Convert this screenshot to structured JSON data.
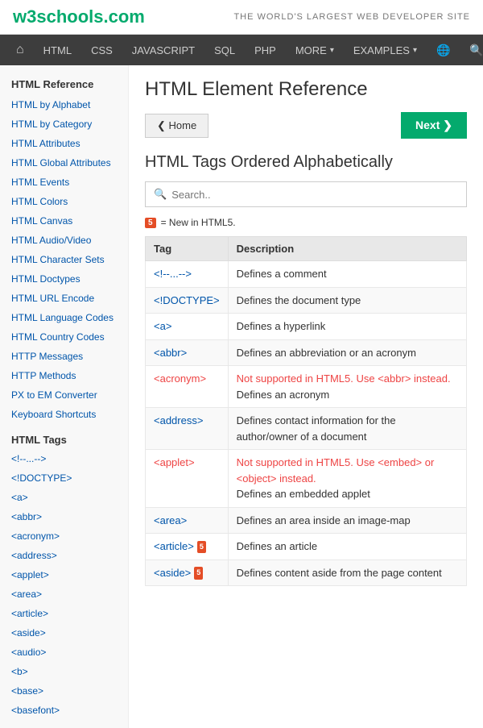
{
  "header": {
    "logo_text": "w3schools",
    "logo_tld": ".com",
    "tagline": "THE WORLD'S LARGEST WEB DEVELOPER SITE"
  },
  "nav": {
    "items": [
      {
        "label": "🏠",
        "id": "home",
        "isIcon": true
      },
      {
        "label": "HTML"
      },
      {
        "label": "CSS"
      },
      {
        "label": "JAVASCRIPT"
      },
      {
        "label": "SQL"
      },
      {
        "label": "PHP"
      },
      {
        "label": "MORE ▾"
      },
      {
        "label": "EXAMPLES ▾"
      },
      {
        "label": "🌐"
      },
      {
        "label": "🔍"
      }
    ]
  },
  "sidebar": {
    "section1_title": "HTML Reference",
    "links1": [
      "HTML by Alphabet",
      "HTML by Category",
      "HTML Attributes",
      "HTML Global Attributes",
      "HTML Events",
      "HTML Colors",
      "HTML Canvas",
      "HTML Audio/Video",
      "HTML Character Sets",
      "HTML Doctypes",
      "HTML URL Encode",
      "HTML Language Codes",
      "HTML Country Codes",
      "HTTP Messages",
      "HTTP Methods",
      "PX to EM Converter",
      "Keyboard Shortcuts"
    ],
    "section2_title": "HTML Tags",
    "links2": [
      "<!--...-->",
      "<!DOCTYPE>",
      "<a>",
      "<abbr>",
      "<acronym>",
      "<address>",
      "<applet>",
      "<area>",
      "<article>",
      "<aside>",
      "<audio>",
      "<b>",
      "<base>",
      "<basefont>"
    ]
  },
  "main": {
    "page_title": "HTML Element Reference",
    "btn_home": "❮ Home",
    "btn_next": "Next ❯",
    "section_title": "HTML Tags Ordered Alphabetically",
    "search_placeholder": "Search..",
    "legend_badge": "5",
    "legend_text": "= New in HTML5.",
    "table": {
      "headers": [
        "Tag",
        "Description"
      ],
      "rows": [
        {
          "tag": "<!--...-->",
          "description": "Defines a comment",
          "deprecated": false,
          "html5": false
        },
        {
          "tag": "<!DOCTYPE>",
          "description": "Defines the document type",
          "deprecated": false,
          "html5": false
        },
        {
          "tag": "<a>",
          "description": "Defines a hyperlink",
          "deprecated": false,
          "html5": false
        },
        {
          "tag": "<abbr>",
          "description": "Defines an abbreviation or an acronym",
          "deprecated": false,
          "html5": false
        },
        {
          "tag": "<acronym>",
          "description": "Not supported in HTML5. Use <abbr> instead.\nDefines an acronym",
          "deprecated": true,
          "html5": false,
          "deprecated_note": "Not supported in HTML5. Use <abbr> instead.",
          "normal_note": "Defines an acronym"
        },
        {
          "tag": "<address>",
          "description": "Defines contact information for the author/owner of a document",
          "deprecated": false,
          "html5": false
        },
        {
          "tag": "<applet>",
          "description_deprecated": "Not supported in HTML5. Use <embed> or <object> instead.",
          "description_normal": "Defines an embedded applet",
          "deprecated": true,
          "html5": false
        },
        {
          "tag": "<area>",
          "description": "Defines an area inside an image-map",
          "deprecated": false,
          "html5": false
        },
        {
          "tag": "<article>",
          "description": "Defines an article",
          "deprecated": false,
          "html5": true
        },
        {
          "tag": "<aside>",
          "description": "Defines content aside from the page content",
          "deprecated": false,
          "html5": true
        }
      ]
    }
  }
}
